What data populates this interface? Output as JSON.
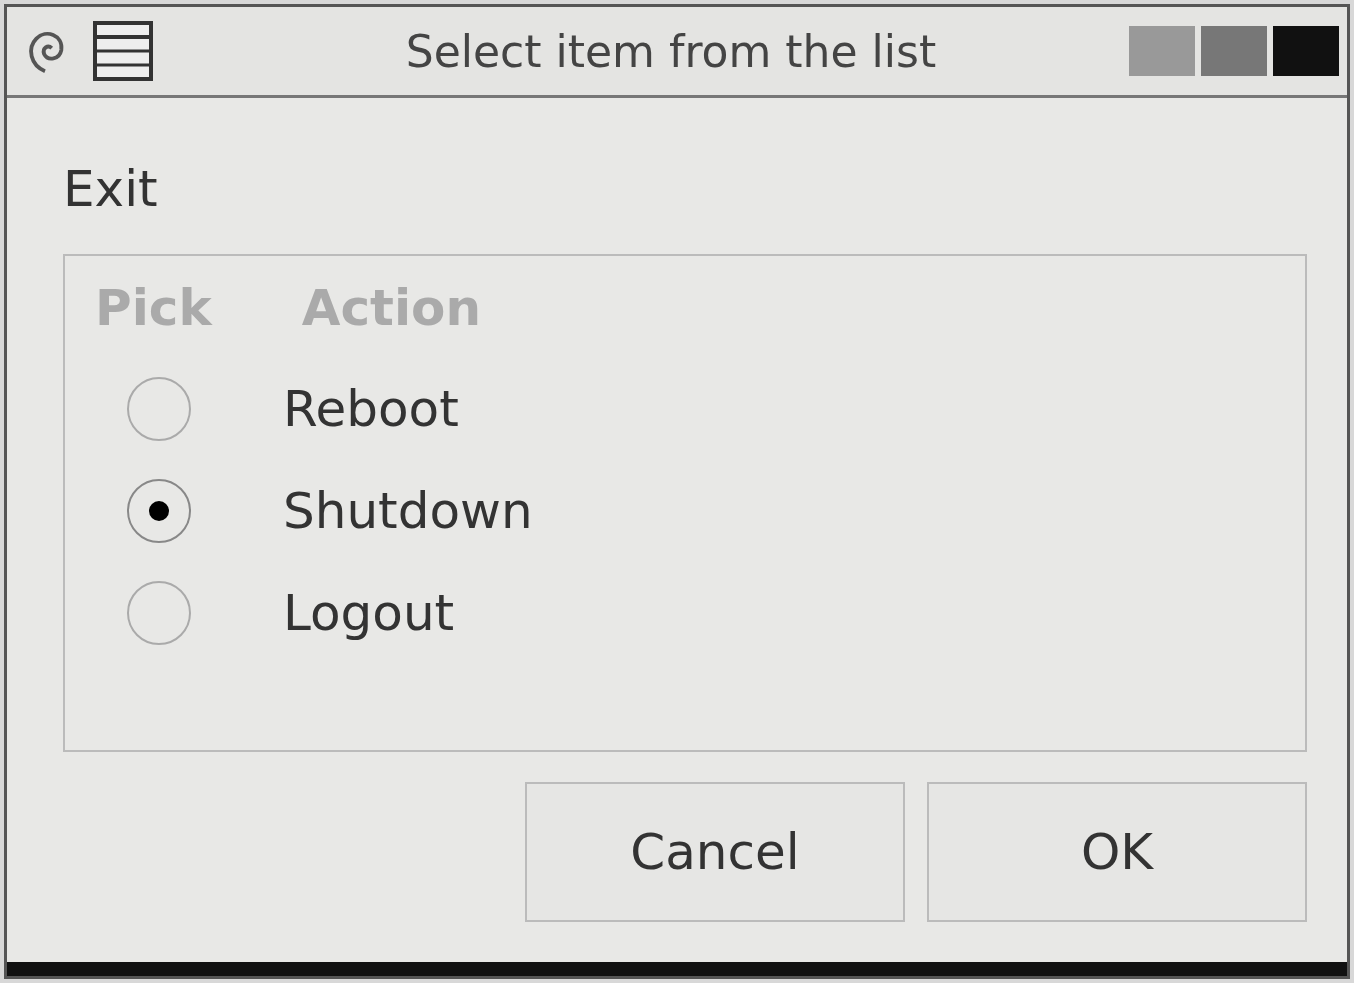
{
  "window": {
    "title": "Select item from the list"
  },
  "prompt": "Exit",
  "list": {
    "columns": [
      "Pick",
      "Action"
    ],
    "rows": [
      {
        "label": "Reboot",
        "selected": false
      },
      {
        "label": "Shutdown",
        "selected": true
      },
      {
        "label": "Logout",
        "selected": false
      }
    ]
  },
  "buttons": [
    "Cancel",
    "OK"
  ]
}
